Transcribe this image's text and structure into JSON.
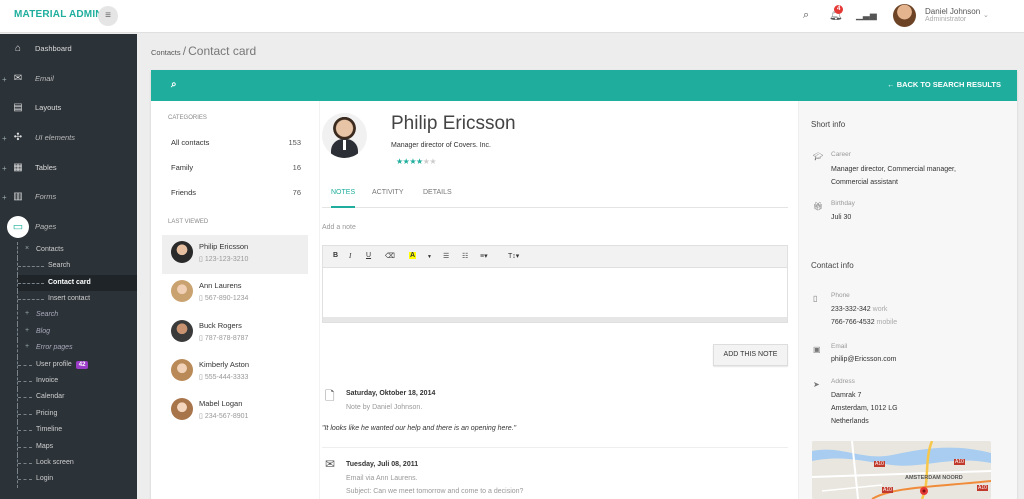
{
  "app": {
    "brand": "MATERIAL ADMIN"
  },
  "header": {
    "menu_icon": "hamburger-icon",
    "notification_count": "4",
    "user_name": "Daniel Johnson",
    "user_role": "Administrator"
  },
  "sidebar": {
    "items": [
      {
        "label": "Dashboard"
      },
      {
        "label": "Email"
      },
      {
        "label": "Layouts"
      },
      {
        "label": "UI elements"
      },
      {
        "label": "Tables"
      },
      {
        "label": "Forms"
      },
      {
        "label": "Pages"
      }
    ],
    "sub": {
      "contacts": "Contacts",
      "search": "Search",
      "contact_card": "Contact card",
      "insert_contact": "Insert contact",
      "search2": "Search",
      "blog": "Blog",
      "error_pages": "Error pages",
      "user_profile": "User profile",
      "user_profile_badge": "42",
      "invoice": "Invoice",
      "calendar": "Calendar",
      "pricing": "Pricing",
      "timeline": "Timeline",
      "maps": "Maps",
      "lock_screen": "Lock screen",
      "login": "Login"
    }
  },
  "breadcrumb": {
    "parent": "Contacts",
    "separator": "/",
    "current": "Contact card"
  },
  "card": {
    "back_label": "BACK TO SEARCH RESULTS"
  },
  "categories": {
    "title": "CATEGORIES",
    "items": [
      {
        "label": "All contacts",
        "count": "153"
      },
      {
        "label": "Family",
        "count": "16"
      },
      {
        "label": "Friends",
        "count": "76"
      }
    ]
  },
  "last_viewed": {
    "title": "LAST VIEWED",
    "items": [
      {
        "name": "Philip Ericsson",
        "phone": "123-123-3210"
      },
      {
        "name": "Ann Laurens",
        "phone": "567-890-1234"
      },
      {
        "name": "Buck Rogers",
        "phone": "787-878-8787"
      },
      {
        "name": "Kimberly Aston",
        "phone": "555-444-3333"
      },
      {
        "name": "Mabel Logan",
        "phone": "234-567-8901"
      }
    ]
  },
  "profile": {
    "name": "Philip Ericsson",
    "role": "Manager director of Covers. Inc.",
    "rating": 4,
    "rating_max": 5
  },
  "tabs": [
    {
      "label": "NOTES"
    },
    {
      "label": "ACTIVITY"
    },
    {
      "label": "DETAILS"
    }
  ],
  "note": {
    "placeholder": "Add a note",
    "add_button": "ADD THIS NOTE"
  },
  "timeline": [
    {
      "date": "Saturday, Oktober 18, 2014",
      "by": "Note by Daniel Johnson.",
      "quote": "\"It looks like he wanted our help and there is an opening here.\""
    },
    {
      "date": "Tuesday, Juli 08, 2011",
      "by": "Email via Ann Laurens.",
      "subject": "Subject: Can we meet tomorrow and come to a decision?"
    }
  ],
  "short_info": {
    "title": "Short info",
    "career_label": "Career",
    "career_value": "Manager director, Commercial manager, Commercial assistant",
    "birthday_label": "Birthday",
    "birthday_value": "Juli 30"
  },
  "contact_info": {
    "title": "Contact info",
    "phone_label": "Phone",
    "phones": [
      {
        "number": "233-332-342",
        "type": "work"
      },
      {
        "number": "766-766-4532",
        "type": "mobile"
      }
    ],
    "email_label": "Email",
    "email": "philip@Ericsson.com",
    "address_label": "Address",
    "address_lines": [
      "Damrak 7",
      "Amsterdam, 1012 LG",
      "Netherlands"
    ]
  },
  "map": {
    "label_1": "A10",
    "label_2": "A10",
    "label_3": "AMSTERDAM NOORD",
    "label_4": "A10",
    "label_5": "A10"
  }
}
